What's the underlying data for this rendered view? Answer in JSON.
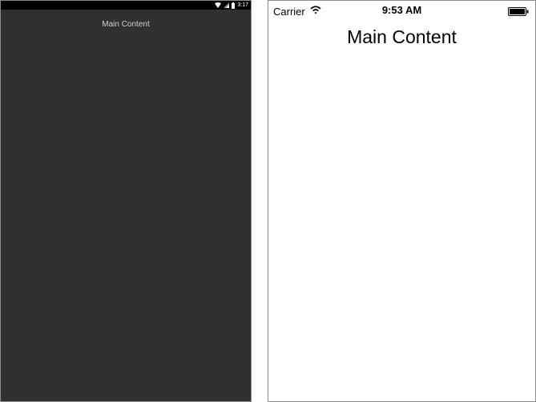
{
  "android": {
    "status_bar": {
      "icons": [
        "wifi-icon",
        "signal-icon",
        "battery-icon"
      ],
      "time": "3:17",
      "background": "#000000"
    },
    "main_content": "Main Content",
    "background": "#303030"
  },
  "ios": {
    "status_bar": {
      "carrier": "Carrier",
      "icons": [
        "wifi-icon",
        "battery-icon"
      ],
      "time": "9:53 AM"
    },
    "main_content": "Main Content",
    "background": "#ffffff"
  }
}
